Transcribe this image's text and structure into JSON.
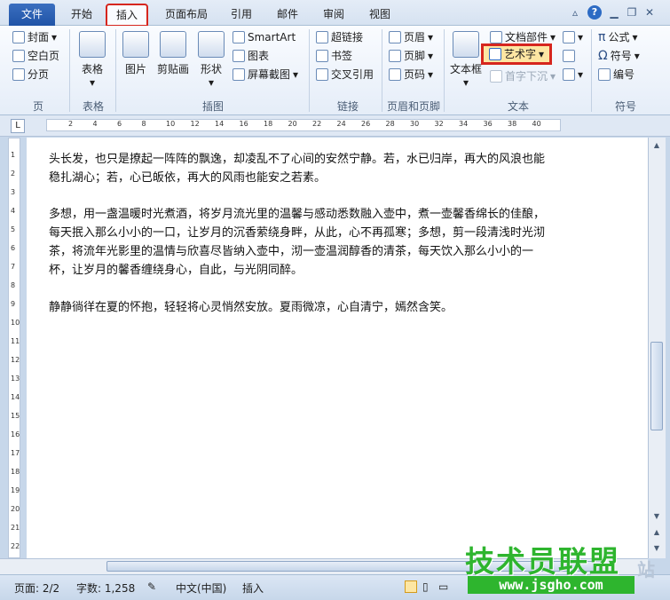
{
  "tabs": {
    "file": "文件",
    "home": "开始",
    "insert": "插入",
    "layout": "页面布局",
    "references": "引用",
    "mailings": "邮件",
    "review": "审阅",
    "view": "视图"
  },
  "help_icon": "?",
  "ribbon": {
    "pages": {
      "cover": "封面",
      "blank": "空白页",
      "break": "分页",
      "label": "页"
    },
    "tables": {
      "table": "表格",
      "label": "表格"
    },
    "illustrations": {
      "picture": "图片",
      "clipart": "剪贴画",
      "shapes": "形状",
      "smartart": "SmartArt",
      "chart": "图表",
      "screenshot": "屏幕截图",
      "label": "插图"
    },
    "links": {
      "hyperlink": "超链接",
      "bookmark": "书签",
      "crossref": "交叉引用",
      "label": "链接"
    },
    "header_footer": {
      "header": "页眉",
      "footer": "页脚",
      "page_number": "页码",
      "label": "页眉和页脚"
    },
    "text": {
      "textbox": "文本框",
      "quickparts": "文档部件",
      "wordart": "艺术字",
      "dropcap": "首字下沉",
      "label": "文本"
    },
    "symbols": {
      "equation": "公式",
      "symbol": "符号",
      "numbering": "编号",
      "label": "符号",
      "pi": "π",
      "omega": "Ω"
    }
  },
  "ruler_marks": [
    "2",
    "4",
    "6",
    "8",
    "10",
    "12",
    "14",
    "16",
    "18",
    "20",
    "22",
    "24",
    "26",
    "28",
    "30",
    "32",
    "34",
    "36",
    "38",
    "40"
  ],
  "vruler_marks": [
    "1",
    "2",
    "3",
    "4",
    "5",
    "6",
    "7",
    "8",
    "9",
    "10",
    "11",
    "12",
    "13",
    "14",
    "15",
    "16",
    "17",
    "18",
    "19",
    "20",
    "21",
    "22"
  ],
  "document": {
    "p1": "头长发，也只是撩起一阵阵的飘逸，却凌乱不了心间的安然宁静。若，水已归岸，再大的风浪也能稳扎湖心；若，心已皈依，再大的风雨也能安之若素。",
    "p2": "多想，用一盏温暖时光煮酒，将岁月流光里的温馨与感动悉数融入壶中，煮一壶馨香绵长的佳酿，每天抿入那么小小的一口，让岁月的沉香萦绕身畔，从此，心不再孤寒；多想，剪一段清浅时光沏茶，将流年光影里的温情与欣喜尽皆纳入壶中，沏一壶温润醇香的清茶，每天饮入那么小小的一杯，让岁月的馨香缠绕身心，自此，与光阴同醉。",
    "p3": "静静徜徉在夏的怀抱，轻轻将心灵悄然安放。夏雨微凉，心自清宁，嫣然含笑。"
  },
  "status": {
    "page": "页面: 2/2",
    "words": "字数: 1,258",
    "language": "中文(中国)",
    "mode": "插入"
  },
  "watermark": {
    "title": "技术员联盟",
    "url": "www.jsgho.com",
    "corner": "站"
  }
}
